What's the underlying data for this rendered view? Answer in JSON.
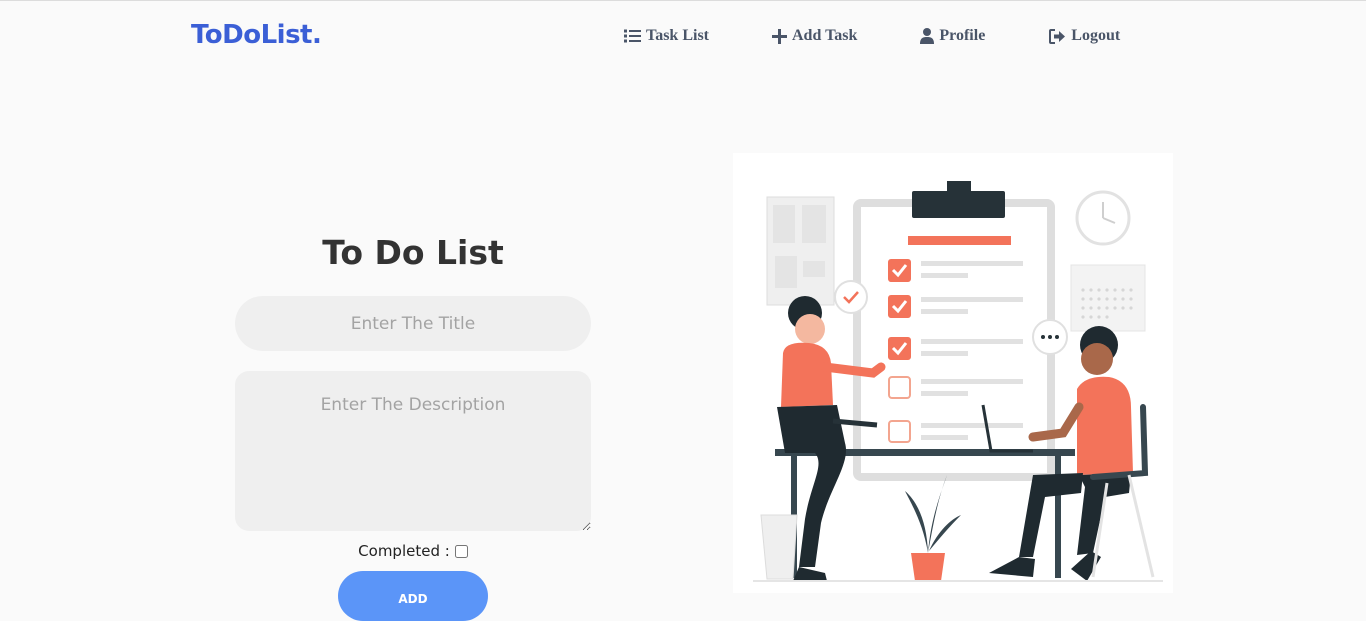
{
  "brand": {
    "name": "ToDoList."
  },
  "nav": {
    "items": [
      {
        "label": "Task List",
        "icon": "list-icon"
      },
      {
        "label": "Add Task",
        "icon": "plus-icon"
      },
      {
        "label": "Profile",
        "icon": "user-icon"
      },
      {
        "label": "Logout",
        "icon": "logout-icon"
      }
    ]
  },
  "form": {
    "heading": "To Do List",
    "title_placeholder": "Enter The Title",
    "description_placeholder": "Enter The Description",
    "completed_label": "Completed :",
    "completed_checked": false,
    "add_label": "ADD"
  },
  "colors": {
    "brand": "#3b5fd6",
    "nav_text": "#4a5568",
    "button": "#5b95f8",
    "input_bg": "#efefef",
    "illustration_accent": "#f3735a"
  }
}
